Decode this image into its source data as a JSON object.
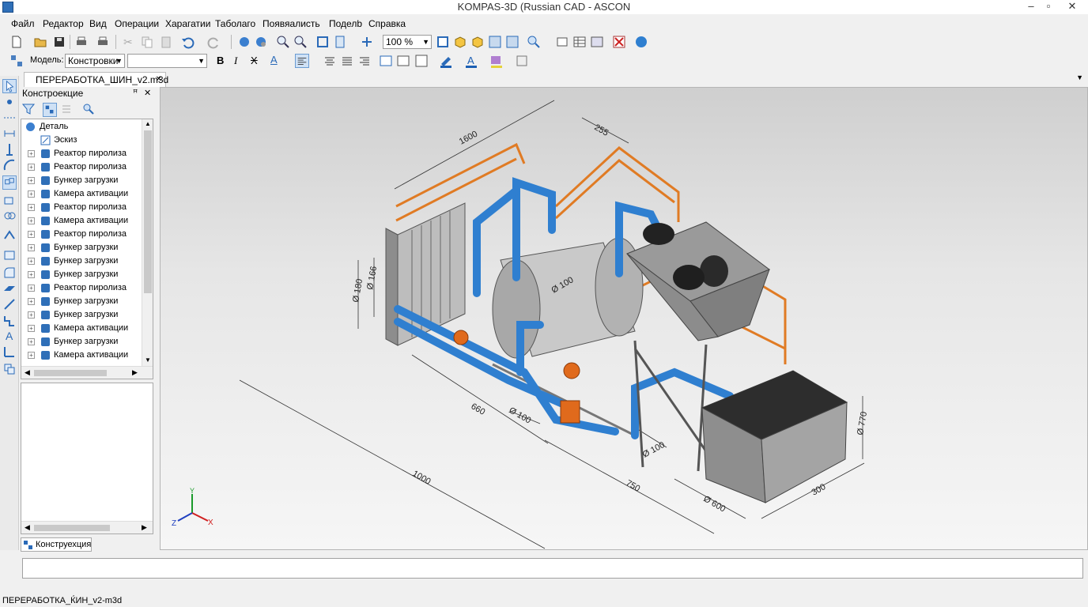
{
  "window": {
    "title": "KOMPAS-3D (Russian CAD - ASCON",
    "controls": {
      "minimize": "–",
      "restore": "▫",
      "close": "✕"
    }
  },
  "menu": [
    "Файл",
    "Редактор",
    "Вид",
    "Операции",
    "Харагатии",
    "Таболаго",
    "Появяалисть",
    "Поделb",
    "Справка"
  ],
  "toolbar": {
    "zoom_value": "100 %",
    "model_label": "Модель:",
    "model_value": "Констровки",
    "style_value": "",
    "bold": "B",
    "italic": "I",
    "strike": "X",
    "text_a": "A"
  },
  "document_tab": {
    "label": "ПЕРЕРАБОТКА_ШИН_v2.m3d",
    "close": "✕"
  },
  "panel": {
    "title": "Констроекцие",
    "pin": "ꟸ",
    "close": "✕",
    "tab_label": "Конструехция",
    "tree": [
      {
        "label": "Деталь",
        "level": 0,
        "icon": "part"
      },
      {
        "label": "Эскиз",
        "level": 1,
        "icon": "sketch"
      },
      {
        "label": "Реактор пиролиза",
        "level": 1,
        "icon": "body"
      },
      {
        "label": "Реактор пиролиза",
        "level": 1,
        "icon": "body"
      },
      {
        "label": "Бункер загрузки",
        "level": 1,
        "icon": "body"
      },
      {
        "label": "Камера активации",
        "level": 1,
        "icon": "body"
      },
      {
        "label": "Реактор пиролиза",
        "level": 1,
        "icon": "body"
      },
      {
        "label": "Камера активации",
        "level": 1,
        "icon": "body"
      },
      {
        "label": "Реактор пиролиза",
        "level": 1,
        "icon": "body"
      },
      {
        "label": "Бункер загрузки",
        "level": 1,
        "icon": "body"
      },
      {
        "label": "Бункер загрузки",
        "level": 1,
        "icon": "body"
      },
      {
        "label": "Бункер загрузки",
        "level": 1,
        "icon": "body"
      },
      {
        "label": "Реактор пиролиза",
        "level": 1,
        "icon": "body"
      },
      {
        "label": "Бункер загрузки",
        "level": 1,
        "icon": "body"
      },
      {
        "label": "Бункер загрузки",
        "level": 1,
        "icon": "body"
      },
      {
        "label": "Камера активации",
        "level": 1,
        "icon": "body"
      },
      {
        "label": "Бункер загрузки",
        "level": 1,
        "icon": "body"
      },
      {
        "label": "Камера активации",
        "level": 1,
        "icon": "body"
      }
    ]
  },
  "viewport": {
    "dimensions": [
      "1600",
      "255",
      "Ø 180",
      "Ø 166",
      "Ø 100",
      "660",
      "Ø 100",
      "1000",
      "750",
      "Ø 600",
      "300",
      "Ø 770"
    ],
    "triad": {
      "x": "X",
      "y": "Y",
      "z": "Z"
    }
  },
  "status_bar": {
    "text": "ПЕРЕРАБОТКА_ЌИН_v2-m3d"
  },
  "colors": {
    "pipe": "#2f7fd0",
    "rail": "#e07b24",
    "steel": "#9a9a9a",
    "accent": "#1c5fb3"
  }
}
